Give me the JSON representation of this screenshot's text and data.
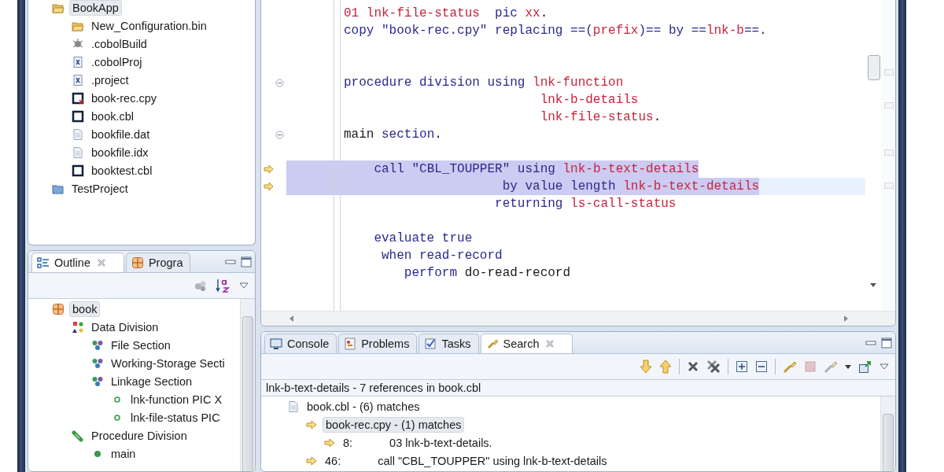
{
  "project_explorer": {
    "items": [
      {
        "label": "BookApp",
        "kind": "project-open",
        "selected": true,
        "children": [
          {
            "label": "New_Configuration.bin",
            "kind": "folder",
            "selected": false
          },
          {
            "label": ".cobolBuild",
            "kind": "build",
            "selected": false
          },
          {
            "label": ".cobolProj",
            "kind": "xml",
            "selected": false
          },
          {
            "label": ".project",
            "kind": "xml",
            "selected": false
          },
          {
            "label": "book-rec.cpy",
            "kind": "cobol-error",
            "selected": false
          },
          {
            "label": "book.cbl",
            "kind": "cobol",
            "selected": false
          },
          {
            "label": "bookfile.dat",
            "kind": "file",
            "selected": false
          },
          {
            "label": "bookfile.idx",
            "kind": "file",
            "selected": false
          },
          {
            "label": "booktest.cbl",
            "kind": "cobol",
            "selected": false
          }
        ]
      },
      {
        "label": "TestProject",
        "kind": "project",
        "selected": false
      }
    ]
  },
  "outline": {
    "tabs": [
      {
        "label": "Outline",
        "kind": "outline",
        "selected": true
      },
      {
        "label": "Progra",
        "kind": "program",
        "selected": false
      }
    ],
    "items": [
      {
        "label": "book",
        "kind": "program",
        "selected": true,
        "children": [
          {
            "label": "Data Division",
            "kind": "division",
            "selected": false,
            "children": [
              {
                "label": "File Section",
                "kind": "section",
                "selected": false
              },
              {
                "label": "Working-Storage Secti",
                "kind": "section",
                "selected": false
              },
              {
                "label": "Linkage Section",
                "kind": "section",
                "selected": false,
                "children": [
                  {
                    "label": "lnk-function PIC X",
                    "kind": "field",
                    "selected": false
                  },
                  {
                    "label": "lnk-file-status PIC",
                    "kind": "field",
                    "selected": false
                  }
                ]
              }
            ]
          },
          {
            "label": "Procedure Division",
            "kind": "procedure",
            "selected": false,
            "children": [
              {
                "label": "main",
                "kind": "paragraph",
                "selected": false
              }
            ]
          }
        ]
      }
    ]
  },
  "editor": {
    "lines": [
      {
        "marker": false,
        "fold": false,
        "selected": false,
        "current": false,
        "segments": [
          {
            "kind": "id",
            "text": "01 lnk-file-status"
          },
          {
            "kind": "kw",
            "text": "  pic "
          },
          {
            "kind": "id",
            "text": "xx"
          },
          {
            "kind": "plain",
            "text": "."
          }
        ]
      },
      {
        "marker": false,
        "fold": false,
        "selected": false,
        "current": false,
        "segments": [
          {
            "kind": "kw",
            "text": "copy "
          },
          {
            "kind": "str",
            "text": "\"book-rec.cpy\""
          },
          {
            "kind": "kw",
            "text": " replacing ==("
          },
          {
            "kind": "id",
            "text": "prefix"
          },
          {
            "kind": "kw",
            "text": ")== by =="
          },
          {
            "kind": "id",
            "text": "lnk-b"
          },
          {
            "kind": "kw",
            "text": "==."
          }
        ]
      },
      {
        "marker": false,
        "fold": false,
        "selected": false,
        "current": false
      },
      {
        "marker": false,
        "fold": false,
        "selected": false,
        "current": false
      },
      {
        "marker": false,
        "fold": true,
        "selected": false,
        "current": false,
        "segments": [
          {
            "kind": "kw",
            "text": "procedure division using "
          },
          {
            "kind": "id",
            "text": "lnk-function"
          }
        ]
      },
      {
        "marker": false,
        "fold": false,
        "selected": false,
        "current": false,
        "segments": [
          {
            "kind": "id",
            "text": "                          lnk-b-details"
          }
        ]
      },
      {
        "marker": false,
        "fold": false,
        "selected": false,
        "current": false,
        "segments": [
          {
            "kind": "id",
            "text": "                          lnk-file-status"
          },
          {
            "kind": "plain",
            "text": "."
          }
        ]
      },
      {
        "marker": false,
        "fold": true,
        "selected": false,
        "current": false,
        "segments": [
          {
            "kind": "plain",
            "text": "main "
          },
          {
            "kind": "kw",
            "text": "section"
          },
          {
            "kind": "plain",
            "text": "."
          }
        ]
      },
      {
        "marker": false,
        "fold": false,
        "selected": false,
        "current": false
      },
      {
        "marker": true,
        "fold": false,
        "selected": true,
        "current": false,
        "segments": [
          {
            "kind": "kw",
            "text": "    call "
          },
          {
            "kind": "str",
            "text": "\"CBL_TOUPPER\""
          },
          {
            "kind": "kw",
            "text": " using "
          },
          {
            "kind": "id",
            "text": "lnk-b-text-details"
          }
        ]
      },
      {
        "marker": true,
        "fold": false,
        "selected": true,
        "current": true,
        "segments": [
          {
            "kind": "kw",
            "text": "                     by value length "
          },
          {
            "kind": "id",
            "text": "lnk-b-text-details"
          }
        ]
      },
      {
        "marker": false,
        "fold": false,
        "selected": false,
        "current": false,
        "segments": [
          {
            "kind": "kw",
            "text": "                    returning "
          },
          {
            "kind": "id",
            "text": "ls-call-status"
          }
        ]
      },
      {
        "marker": false,
        "fold": false,
        "selected": false,
        "current": false
      },
      {
        "marker": false,
        "fold": false,
        "selected": false,
        "current": false,
        "segments": [
          {
            "kind": "kw",
            "text": "    evaluate true"
          }
        ]
      },
      {
        "marker": false,
        "fold": false,
        "selected": false,
        "current": false,
        "segments": [
          {
            "kind": "kw",
            "text": "     when read-record"
          }
        ]
      },
      {
        "marker": false,
        "fold": false,
        "selected": false,
        "current": false,
        "segments": [
          {
            "kind": "kw",
            "text": "        perform "
          },
          {
            "kind": "plain",
            "text": "do-read-record"
          }
        ]
      }
    ]
  },
  "bottom_panel": {
    "tabs": [
      {
        "label": "Console",
        "kind": "console",
        "selected": false
      },
      {
        "label": "Problems",
        "kind": "problems",
        "selected": false
      },
      {
        "label": "Tasks",
        "kind": "tasks",
        "selected": false
      },
      {
        "label": "Search",
        "kind": "search",
        "selected": true
      }
    ],
    "summary": "lnk-b-text-details - 7 references in book.cbl",
    "results": [
      {
        "kind": "file",
        "label": "book.cbl - (6) matches",
        "selected": false,
        "children": [
          {
            "kind": "file-match",
            "label": "book-rec.cpy - (1) matches",
            "selected": true,
            "children": [
              {
                "kind": "match",
                "line_no": "8:",
                "text": "03 lnk-b-text-details.",
                "selected": false
              }
            ]
          },
          {
            "kind": "match",
            "line_no": "46:",
            "text": "call \"CBL_TOUPPER\" using lnk-b-text-details",
            "selected": false
          }
        ]
      }
    ]
  }
}
